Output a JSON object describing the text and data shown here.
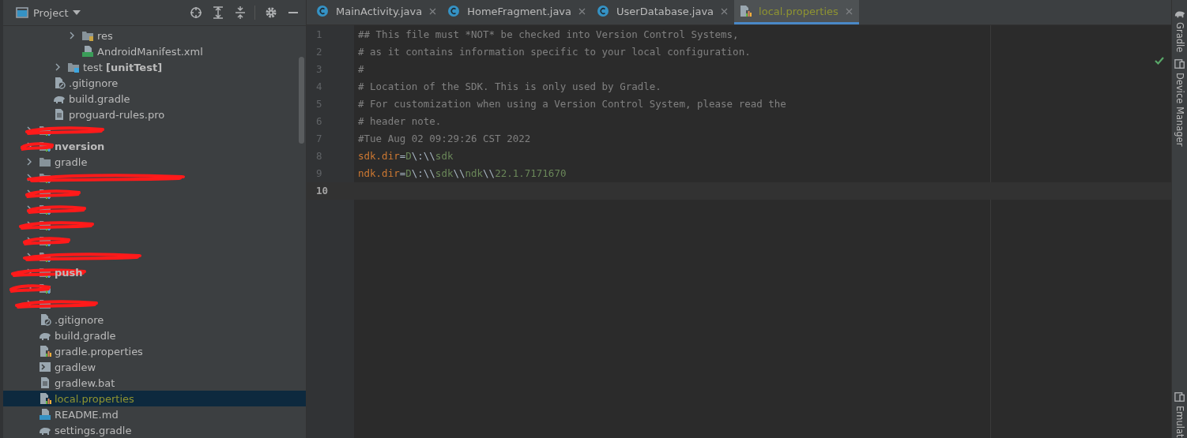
{
  "project_panel": {
    "title": "Project",
    "tree": [
      {
        "children": [
          {
            "children": [
              {
                "children": [
                  {
                    "kind": "res",
                    "label": "res",
                    "expanded": false,
                    "ignored": false,
                    "selected": false
                  },
                  {
                    "kind": "manifest",
                    "label": "AndroidManifest.xml",
                    "ignored": false,
                    "selected": false
                  }
                ]
              },
              {
                "kind": "test",
                "label": "test **[unitTest]**",
                "expanded": false,
                "ignored": false,
                "selected": false
              }
            ]
          },
          {
            "kind": "ignore",
            "label": ".gitignore",
            "ignored": false,
            "selected": false
          },
          {
            "kind": "gradle",
            "label": "build.gradle",
            "ignored": false,
            "selected": false
          },
          {
            "kind": "text",
            "label": "proguard-rules.pro",
            "ignored": false,
            "selected": false
          }
        ]
      },
      {
        "kind": "module",
        "redacted": true,
        "expanded": false,
        "selected": false
      },
      {
        "kind": "module",
        "redacted": true,
        "label": "nversion",
        "expanded": false,
        "selected": false
      },
      {
        "kind": "folder",
        "redacted": false,
        "label": "gradle",
        "expanded": false,
        "ignored": false,
        "selected": false
      },
      {
        "kind": "module",
        "redacted": true,
        "expanded": false,
        "selected": false
      },
      {
        "kind": "module",
        "redacted": true,
        "expanded": false,
        "selected": false
      },
      {
        "kind": "module",
        "redacted": true,
        "expanded": false,
        "selected": false
      },
      {
        "kind": "module",
        "redacted": true,
        "expanded": false,
        "selected": false
      },
      {
        "kind": "module",
        "redacted": true,
        "expanded": false,
        "selected": false
      },
      {
        "kind": "module",
        "redacted": true,
        "expanded": false,
        "selected": false
      },
      {
        "kind": "module",
        "redacted": true,
        "label": "push",
        "expanded": false,
        "selected": false
      },
      {
        "kind": "module",
        "redacted": true,
        "expanded": false,
        "selected": false
      },
      {
        "kind": "folder",
        "redacted": true,
        "expanded": false,
        "selected": false
      },
      {
        "kind": "ignore",
        "label": ".gitignore",
        "ignored": false,
        "selected": false
      },
      {
        "kind": "gradle",
        "label": "build.gradle",
        "ignored": false,
        "selected": false
      },
      {
        "kind": "properties",
        "label": "gradle.properties",
        "ignored": false,
        "selected": false
      },
      {
        "kind": "shell",
        "label": "gradlew",
        "ignored": false,
        "selected": false
      },
      {
        "kind": "text",
        "label": "gradlew.bat",
        "ignored": false,
        "selected": false
      },
      {
        "kind": "properties",
        "label": "local.properties",
        "ignored": true,
        "selected": true
      },
      {
        "kind": "markdown",
        "label": "README.md",
        "ignored": false,
        "selected": false
      },
      {
        "kind": "gradle",
        "label": "settings.gradle",
        "ignored": false,
        "selected": false
      }
    ]
  },
  "tabs": [
    {
      "kind": "class",
      "label": "MainActivity.java",
      "selected": false,
      "ignored": false
    },
    {
      "kind": "class",
      "label": "HomeFragment.java",
      "selected": false,
      "ignored": false
    },
    {
      "kind": "abstract",
      "label": "UserDatabase.java",
      "selected": false,
      "ignored": false
    },
    {
      "kind": "properties",
      "label": "local.properties",
      "selected": true,
      "ignored": true
    }
  ],
  "editor": {
    "lines": [
      {
        "number": "1",
        "current": false,
        "tokens": [
          {
            "kind": "comment",
            "text": "## This file must *NOT* be checked into Version Control Systems,"
          }
        ]
      },
      {
        "number": "2",
        "current": false,
        "tokens": [
          {
            "kind": "comment",
            "text": "# as it contains information specific to your local configuration."
          }
        ]
      },
      {
        "number": "3",
        "current": false,
        "tokens": [
          {
            "kind": "comment",
            "text": "#"
          }
        ]
      },
      {
        "number": "4",
        "current": false,
        "tokens": [
          {
            "kind": "comment",
            "text": "# Location of the SDK. This is only used by Gradle."
          }
        ]
      },
      {
        "number": "5",
        "current": false,
        "tokens": [
          {
            "kind": "comment",
            "text": "# For customization when using a Version Control System, please read the"
          }
        ]
      },
      {
        "number": "6",
        "current": false,
        "tokens": [
          {
            "kind": "comment",
            "text": "# header note."
          }
        ]
      },
      {
        "number": "7",
        "current": false,
        "tokens": [
          {
            "kind": "comment",
            "text": "#Tue Aug 02 09:29:26 CST 2022"
          }
        ]
      },
      {
        "number": "8",
        "current": false,
        "tokens": [
          {
            "kind": "key",
            "text": "sdk.dir"
          },
          {
            "kind": "sep",
            "text": "="
          },
          {
            "kind": "value",
            "text": "D"
          },
          {
            "kind": "escape",
            "text": "\\:\\\\"
          },
          {
            "kind": "value",
            "text": "sdk"
          }
        ]
      },
      {
        "number": "9",
        "current": false,
        "tokens": [
          {
            "kind": "key",
            "text": "ndk.dir"
          },
          {
            "kind": "sep",
            "text": "="
          },
          {
            "kind": "value",
            "text": "D"
          },
          {
            "kind": "escape",
            "text": "\\:\\\\"
          },
          {
            "kind": "value",
            "text": "sdk"
          },
          {
            "kind": "escape",
            "text": "\\\\"
          },
          {
            "kind": "value",
            "text": "ndk"
          },
          {
            "kind": "escape",
            "text": "\\\\"
          },
          {
            "kind": "value",
            "text": "22.1.7171670"
          }
        ]
      },
      {
        "number": "10",
        "current": true
      }
    ]
  },
  "right_strip": [
    {
      "kind": "gradle",
      "label": "Gradle"
    },
    {
      "kind": "device",
      "label": "Device Manager"
    },
    {
      "kind": "spacer"
    },
    {
      "kind": "device",
      "label": "Emulat"
    }
  ]
}
